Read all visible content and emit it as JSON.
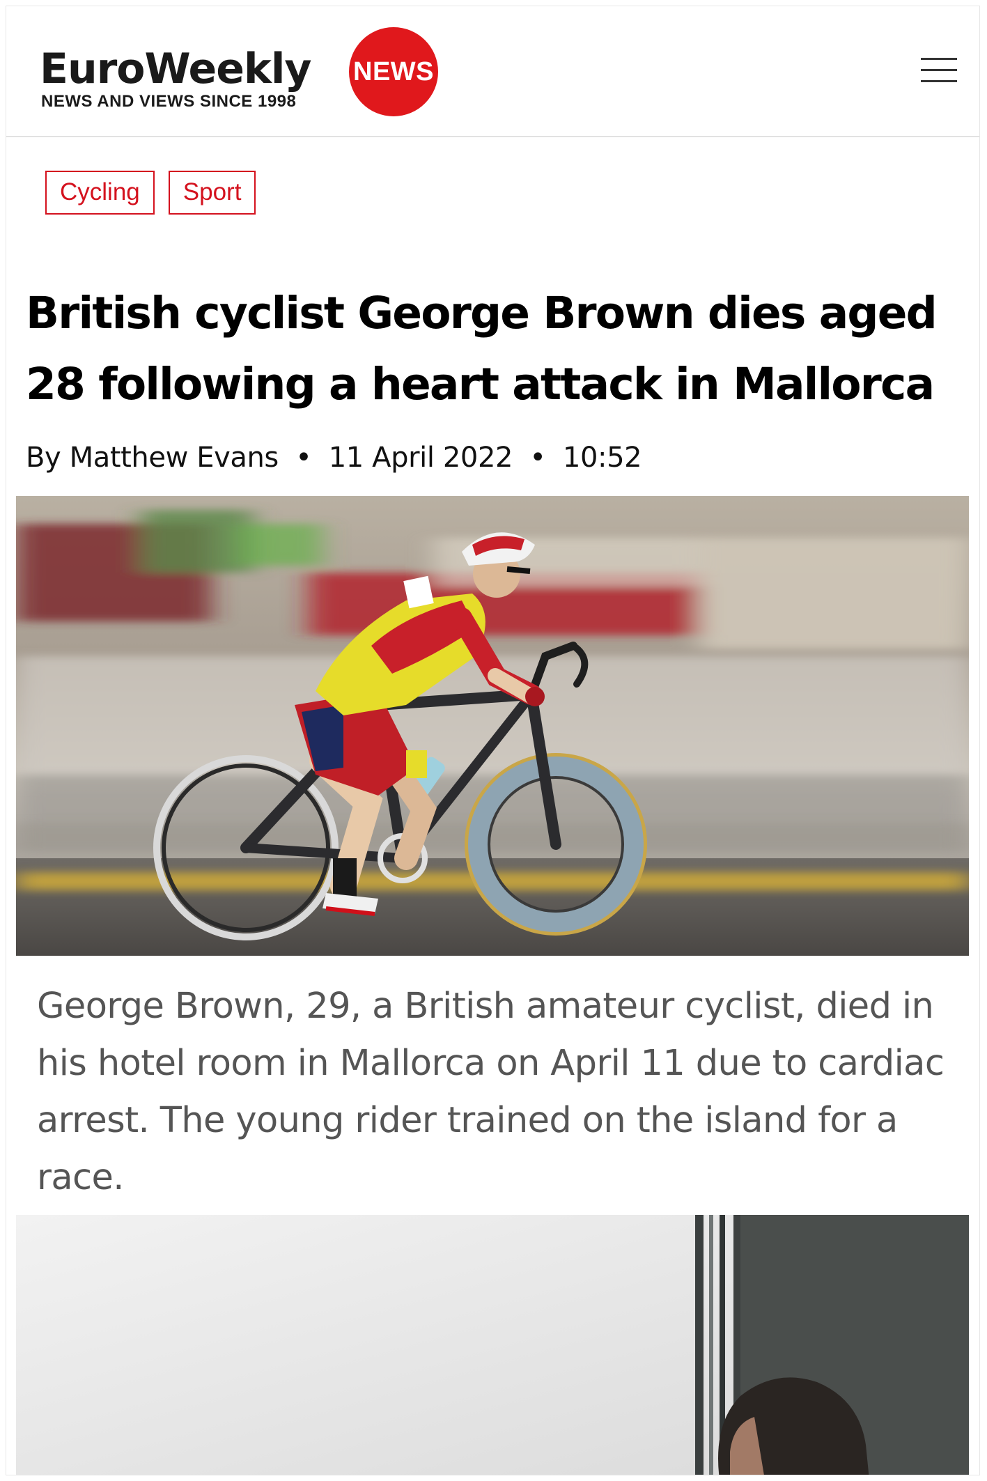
{
  "header": {
    "logo_word": "EuroWeekly",
    "logo_badge": "NEWS",
    "logo_tagline": "NEWS AND VIEWS SINCE 1998",
    "menu_icon": "hamburger-menu-icon"
  },
  "article": {
    "tags": [
      {
        "label": "Cycling"
      },
      {
        "label": "Sport"
      }
    ],
    "headline": "British cyclist George Brown dies aged 28 following a heart attack in Mallorca",
    "byline": {
      "author": "By Matthew Evans",
      "date": "11 April 2022",
      "time": "10:52",
      "separator": "•"
    },
    "lede": "George Brown, 29, a British amateur cyclist, died in his hotel room in Mallorca on April 11 due to cardiac arrest. The young rider trained on the island for a race."
  },
  "colors": {
    "accent_red": "#e0181c",
    "tag_red": "#d4121e",
    "headline_text": "#000000",
    "lede_text": "#555555"
  }
}
